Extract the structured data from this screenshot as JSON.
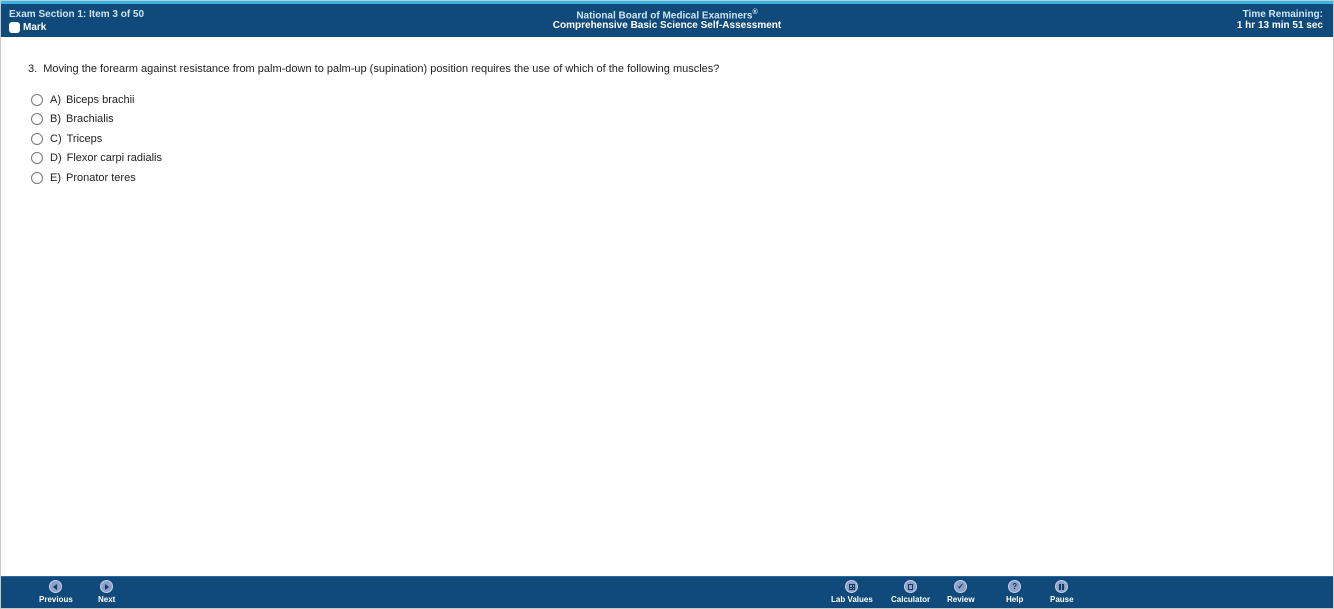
{
  "header": {
    "exam_section": "Exam Section 1: Item 3 of 50",
    "mark_label": "Mark",
    "title_line1": "National Board of Medical Examiners",
    "title_reg": "®",
    "title_line2": "Comprehensive Basic Science Self-Assessment",
    "time_label": "Time Remaining:",
    "time_value": "1 hr 13 min 51 sec"
  },
  "question": {
    "number": "3.",
    "text": "Moving the forearm against resistance from palm-down to palm-up (supination) position requires the use of which of the following muscles?",
    "choices": [
      {
        "letter": "A)",
        "text": "Biceps brachii"
      },
      {
        "letter": "B)",
        "text": "Brachialis"
      },
      {
        "letter": "C)",
        "text": "Triceps"
      },
      {
        "letter": "D)",
        "text": "Flexor carpi radialis"
      },
      {
        "letter": "E)",
        "text": "Pronator teres"
      }
    ]
  },
  "footer": {
    "previous": "Previous",
    "next": "Next",
    "lab_values": "Lab Values",
    "calculator": "Calculator",
    "review": "Review",
    "help": "Help",
    "pause": "Pause",
    "help_glyph": "?"
  },
  "colors": {
    "header_bg": "#0f4a7a",
    "accent_top": "#35b6e6",
    "icon_bg": "#8fa0c8"
  }
}
